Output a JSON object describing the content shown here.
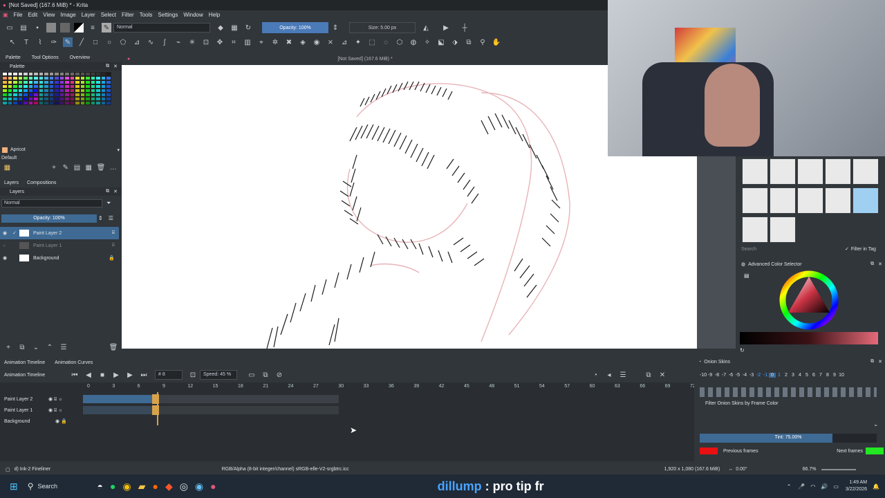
{
  "window": {
    "title": "[Not Saved] (167.6 MiB) * - Krita"
  },
  "menu": [
    "File",
    "Edit",
    "View",
    "Image",
    "Layer",
    "Select",
    "Filter",
    "Tools",
    "Settings",
    "Window",
    "Help"
  ],
  "toolbar": {
    "blend_mode": "Normal",
    "opacity": "Opacity: 100%",
    "opacity_value": 1.0,
    "size": "Size: 5.00 px"
  },
  "left_dock": {
    "tabs": [
      "Palette",
      "Tool Options",
      "Overview"
    ],
    "palette_title": "Palette",
    "swatch_name": "Apricot",
    "palette_name": "Default",
    "layer_tabs": [
      "Layers",
      "Compositions"
    ],
    "layers_title": "Layers",
    "blend": "Normal",
    "opacity": "Opacity: 100%",
    "layers": [
      {
        "name": "Paint Layer 2",
        "selected": true
      },
      {
        "name": "Paint Layer 1",
        "selected": false
      },
      {
        "name": "Background",
        "selected": false
      }
    ]
  },
  "canvas": {
    "doc_title": "[Not Saved] (167.6 MiB) *"
  },
  "brush_panel": {
    "search_placeholder": "Search",
    "filter": "Filter in Tag"
  },
  "color_selector": {
    "title": "Advanced Color Selector"
  },
  "timeline": {
    "tabs": [
      "Animation Timeline",
      "Animation Curves"
    ],
    "title": "Animation Timeline",
    "frame": "# 8",
    "speed": "Speed: 45 %",
    "ruler": [
      "0",
      "3",
      "6",
      "9",
      "12",
      "15",
      "18",
      "21",
      "24",
      "27",
      "30",
      "33",
      "36",
      "39",
      "42",
      "45",
      "48",
      "51",
      "54",
      "57",
      "60",
      "63",
      "66",
      "69",
      "72"
    ],
    "tracks": [
      "Paint Layer 2",
      "Paint Layer 1",
      "Background"
    ]
  },
  "onion": {
    "title": "Onion Skins",
    "numbers": [
      "-10",
      "-9",
      "-8",
      "-7",
      "-6",
      "-5",
      "-4",
      "-3",
      "-2",
      "-1",
      "0",
      "1",
      "2",
      "3",
      "4",
      "5",
      "6",
      "7",
      "8",
      "9",
      "10"
    ],
    "filter_label": "Filter Onion Skins by Frame Color",
    "tint": "Tint: 75.00%",
    "tint_value": 0.75,
    "previous": "Previous frames",
    "next": "Next frames",
    "colors": {
      "previous": "#e81010",
      "next": "#22e822"
    }
  },
  "status": {
    "brush": "d) Ink-2 Fineliner",
    "color_space": "RGB/Alpha (8-bit integer/channel)  sRGB-elle-V2-srgbtrc.icc",
    "dims": "1,920 x 1,080 (167.6 MiB)",
    "rotation": "0.00°",
    "zoom": "66.7%"
  },
  "taskbar": {
    "search": "Search",
    "overlay_user": "dillump",
    "overlay_text": ": pro tip fr",
    "time": "1:49 AM",
    "date": "3/22/2026"
  }
}
